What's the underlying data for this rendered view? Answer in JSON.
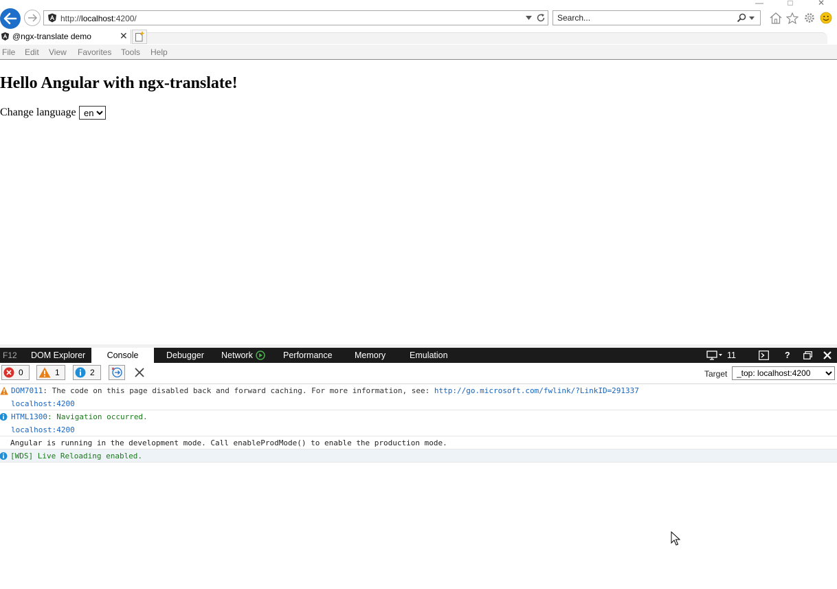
{
  "browser": {
    "address": {
      "prefix": "http://",
      "host": "localhost",
      "suffix": ":4200/"
    },
    "search_placeholder": "Search...",
    "tab_title": "@ngx-translate demo",
    "tab_close": "✕",
    "window_controls": {
      "minimize": "—",
      "maximize": "□",
      "close": "✕"
    },
    "menu": [
      "File",
      "Edit",
      "View",
      "Favorites",
      "Tools",
      "Help"
    ],
    "accent": "#1e6fc9"
  },
  "page": {
    "title": "Hello Angular with ngx-translate!",
    "change_language_label": "Change language",
    "language_selected": "en"
  },
  "devtools": {
    "f12_label": "F12",
    "tabs": [
      "DOM Explorer",
      "Console",
      "Debugger",
      "Network",
      "Performance",
      "Memory",
      "Emulation"
    ],
    "active_tab": "Console",
    "doc_mode": "11",
    "question": "?",
    "filters": {
      "errors": "0",
      "warnings": "1",
      "messages": "2"
    },
    "target_label": "Target",
    "target_value": "_top: localhost:4200",
    "log": [
      {
        "level": "warning",
        "code": "DOM7011",
        "text": ": The code on this page disabled back and forward caching. For more information, see: ",
        "link": "http://go.microsoft.com/fwlink/?LinkID=291337",
        "source": "localhost:4200"
      },
      {
        "level": "info",
        "code": "HTML1300",
        "text": ": Navigation occurred.",
        "source": "localhost:4200"
      },
      {
        "level": "log",
        "text": "Angular is running in the development mode. Call enableProdMode() to enable the production mode."
      },
      {
        "level": "info",
        "text": "[WDS] Live Reloading enabled."
      }
    ],
    "colors": {
      "error": "#d9322c",
      "warning": "#e8801a",
      "info": "#1e8fd6"
    }
  }
}
